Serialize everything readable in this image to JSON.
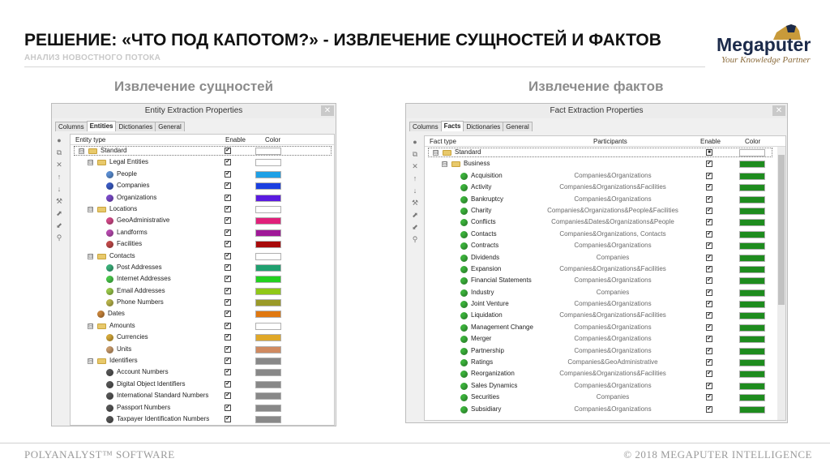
{
  "slide": {
    "title": "РЕШЕНИЕ: «ЧТО ПОД КАПОТОМ?» - ИЗВЛЕЧЕНИЕ СУЩНОСТЕЙ И ФАКТОВ",
    "subtitle": "АНАЛИЗ НОВОСТНОГО ПОТОКА",
    "logo_word": "Megaputer",
    "logo_tagline": "Your Knowledge Partner",
    "left_heading": "Извлечение сущностей",
    "right_heading": "Извлечение фактов",
    "footer_left": "POLYANALYST™ SOFTWARE",
    "footer_right": "© 2018 MEGAPUTER INTELLIGENCE"
  },
  "entity_window": {
    "title": "Entity Extraction Properties",
    "close": "✕",
    "tabs": [
      "Columns",
      "Entities",
      "Dictionaries",
      "General"
    ],
    "active_tab": "Entities",
    "columns": [
      "Entity type",
      "Enable",
      "Color"
    ],
    "rows": [
      {
        "label": "Standard",
        "kind": "folder",
        "level": 0,
        "expander": "⊟",
        "enabled": true,
        "color": "#ffffff"
      },
      {
        "label": "Legal Entities",
        "kind": "folder",
        "level": 1,
        "expander": "⊟",
        "enabled": true,
        "color": "#ffffff"
      },
      {
        "label": "People",
        "kind": "leaf",
        "level": 2,
        "ball": "#5b8fd4",
        "enabled": true,
        "color": "#1ea0e6"
      },
      {
        "label": "Companies",
        "kind": "leaf",
        "level": 2,
        "ball": "#3a5bc4",
        "enabled": true,
        "color": "#1a3fe0"
      },
      {
        "label": "Organizations",
        "kind": "leaf",
        "level": 2,
        "ball": "#7a4ac8",
        "enabled": true,
        "color": "#5a1ae0"
      },
      {
        "label": "Locations",
        "kind": "folder",
        "level": 1,
        "expander": "⊟",
        "enabled": true,
        "color": "#ffffff"
      },
      {
        "label": "GeoAdministrative",
        "kind": "leaf",
        "level": 2,
        "ball": "#d44a8a",
        "enabled": true,
        "color": "#e0207a"
      },
      {
        "label": "Landforms",
        "kind": "leaf",
        "level": 2,
        "ball": "#b84ab0",
        "enabled": true,
        "color": "#a01898"
      },
      {
        "label": "Facilities",
        "kind": "leaf",
        "level": 2,
        "ball": "#c24a4a",
        "enabled": true,
        "color": "#a80a0a"
      },
      {
        "label": "Contacts",
        "kind": "folder",
        "level": 1,
        "expander": "⊟",
        "enabled": true,
        "color": "#ffffff"
      },
      {
        "label": "Post Addresses",
        "kind": "leaf",
        "level": 2,
        "ball": "#3ab07a",
        "enabled": true,
        "color": "#20a070"
      },
      {
        "label": "Internet Addresses",
        "kind": "leaf",
        "level": 2,
        "ball": "#4ac84a",
        "enabled": true,
        "color": "#22d020"
      },
      {
        "label": "Email Addresses",
        "kind": "leaf",
        "level": 2,
        "ball": "#9ac84a",
        "enabled": true,
        "color": "#90c818"
      },
      {
        "label": "Phone Numbers",
        "kind": "leaf",
        "level": 2,
        "ball": "#b8b44a",
        "enabled": true,
        "color": "#9a9a28"
      },
      {
        "label": "Dates",
        "kind": "leaf",
        "level": 1,
        "ball": "#c8843a",
        "enabled": true,
        "color": "#e07810"
      },
      {
        "label": "Amounts",
        "kind": "folder",
        "level": 1,
        "expander": "⊟",
        "enabled": true,
        "color": "#ffffff"
      },
      {
        "label": "Currencies",
        "kind": "leaf",
        "level": 2,
        "ball": "#d4a83a",
        "enabled": true,
        "color": "#e0a828"
      },
      {
        "label": "Units",
        "kind": "leaf",
        "level": 2,
        "ball": "#c89a6a",
        "enabled": true,
        "color": "#d08a60"
      },
      {
        "label": "Identifiers",
        "kind": "folder",
        "level": 1,
        "expander": "⊟",
        "enabled": true,
        "color": "#888888"
      },
      {
        "label": "Account Numbers",
        "kind": "leaf",
        "level": 2,
        "ball": "#555555",
        "enabled": true,
        "color": "#888888"
      },
      {
        "label": "Digital Object Identifiers",
        "kind": "leaf",
        "level": 2,
        "ball": "#555555",
        "enabled": true,
        "color": "#888888"
      },
      {
        "label": "International Standard Numbers",
        "kind": "leaf",
        "level": 2,
        "ball": "#555555",
        "enabled": true,
        "color": "#888888"
      },
      {
        "label": "Passport Numbers",
        "kind": "leaf",
        "level": 2,
        "ball": "#555555",
        "enabled": true,
        "color": "#888888"
      },
      {
        "label": "Taxpayer Identification Numbers",
        "kind": "leaf",
        "level": 2,
        "ball": "#555555",
        "enabled": true,
        "color": "#888888"
      }
    ]
  },
  "fact_window": {
    "title": "Fact Extraction Properties",
    "close": "✕",
    "tabs": [
      "Columns",
      "Facts",
      "Dictionaries",
      "General"
    ],
    "active_tab": "Facts",
    "columns": [
      "Fact type",
      "Participants",
      "Enable",
      "Color"
    ],
    "rows": [
      {
        "label": "Standard",
        "kind": "folder",
        "level": 0,
        "expander": "⊟",
        "participants": "",
        "enabled": "partial",
        "color": "#ffffff"
      },
      {
        "label": "Business",
        "kind": "folder",
        "level": 1,
        "expander": "⊟",
        "participants": "",
        "enabled": true,
        "color": "#1e8c1e"
      },
      {
        "label": "Acquisition",
        "kind": "leaf",
        "level": 2,
        "participants": "Companies&Organizations",
        "enabled": true,
        "color": "#1e8c1e"
      },
      {
        "label": "Activity",
        "kind": "leaf",
        "level": 2,
        "participants": "Companies&Organizations&Facilities",
        "enabled": true,
        "color": "#1e8c1e"
      },
      {
        "label": "Bankruptcy",
        "kind": "leaf",
        "level": 2,
        "participants": "Companies&Organizations",
        "enabled": true,
        "color": "#1e8c1e"
      },
      {
        "label": "Charity",
        "kind": "leaf",
        "level": 2,
        "participants": "Companies&Organizations&People&Facilities",
        "enabled": true,
        "color": "#1e8c1e"
      },
      {
        "label": "Conflicts",
        "kind": "leaf",
        "level": 2,
        "participants": "Companies&Dates&Organizations&People",
        "enabled": true,
        "color": "#1e8c1e"
      },
      {
        "label": "Contacts",
        "kind": "leaf",
        "level": 2,
        "participants": "Companies&Organizations, Contacts",
        "enabled": true,
        "color": "#1e8c1e"
      },
      {
        "label": "Contracts",
        "kind": "leaf",
        "level": 2,
        "participants": "Companies&Organizations",
        "enabled": true,
        "color": "#1e8c1e"
      },
      {
        "label": "Dividends",
        "kind": "leaf",
        "level": 2,
        "participants": "Companies",
        "enabled": true,
        "color": "#1e8c1e"
      },
      {
        "label": "Expansion",
        "kind": "leaf",
        "level": 2,
        "participants": "Companies&Organizations&Facilities",
        "enabled": true,
        "color": "#1e8c1e"
      },
      {
        "label": "Financial Statements",
        "kind": "leaf",
        "level": 2,
        "participants": "Companies&Organizations",
        "enabled": true,
        "color": "#1e8c1e"
      },
      {
        "label": "Industry",
        "kind": "leaf",
        "level": 2,
        "participants": "Companies",
        "enabled": true,
        "color": "#1e8c1e"
      },
      {
        "label": "Joint Venture",
        "kind": "leaf",
        "level": 2,
        "participants": "Companies&Organizations",
        "enabled": true,
        "color": "#1e8c1e"
      },
      {
        "label": "Liquidation",
        "kind": "leaf",
        "level": 2,
        "participants": "Companies&Organizations&Facilities",
        "enabled": true,
        "color": "#1e8c1e"
      },
      {
        "label": "Management Change",
        "kind": "leaf",
        "level": 2,
        "participants": "Companies&Organizations",
        "enabled": true,
        "color": "#1e8c1e"
      },
      {
        "label": "Merger",
        "kind": "leaf",
        "level": 2,
        "participants": "Companies&Organizations",
        "enabled": true,
        "color": "#1e8c1e"
      },
      {
        "label": "Partnership",
        "kind": "leaf",
        "level": 2,
        "participants": "Companies&Organizations",
        "enabled": true,
        "color": "#1e8c1e"
      },
      {
        "label": "Ratings",
        "kind": "leaf",
        "level": 2,
        "participants": "Companies&GeoAdministrative",
        "enabled": true,
        "color": "#1e8c1e"
      },
      {
        "label": "Reorganization",
        "kind": "leaf",
        "level": 2,
        "participants": "Companies&Organizations&Facilities",
        "enabled": true,
        "color": "#1e8c1e"
      },
      {
        "label": "Sales Dynamics",
        "kind": "leaf",
        "level": 2,
        "participants": "Companies&Organizations",
        "enabled": true,
        "color": "#1e8c1e"
      },
      {
        "label": "Securities",
        "kind": "leaf",
        "level": 2,
        "participants": "Companies",
        "enabled": true,
        "color": "#1e8c1e"
      },
      {
        "label": "Subsidiary",
        "kind": "leaf",
        "level": 2,
        "participants": "Companies&Organizations",
        "enabled": true,
        "color": "#1e8c1e"
      }
    ]
  },
  "toolbar_icons": [
    "add-icon",
    "copy-icon",
    "delete-icon",
    "move-up-icon",
    "move-down-icon",
    "wrench-icon",
    "import-icon",
    "export-icon",
    "binoculars-icon"
  ],
  "toolbar_glyphs": [
    "●",
    "⧉",
    "✕",
    "↑",
    "↓",
    "⚒",
    "⬈",
    "⬋",
    "⚲"
  ]
}
